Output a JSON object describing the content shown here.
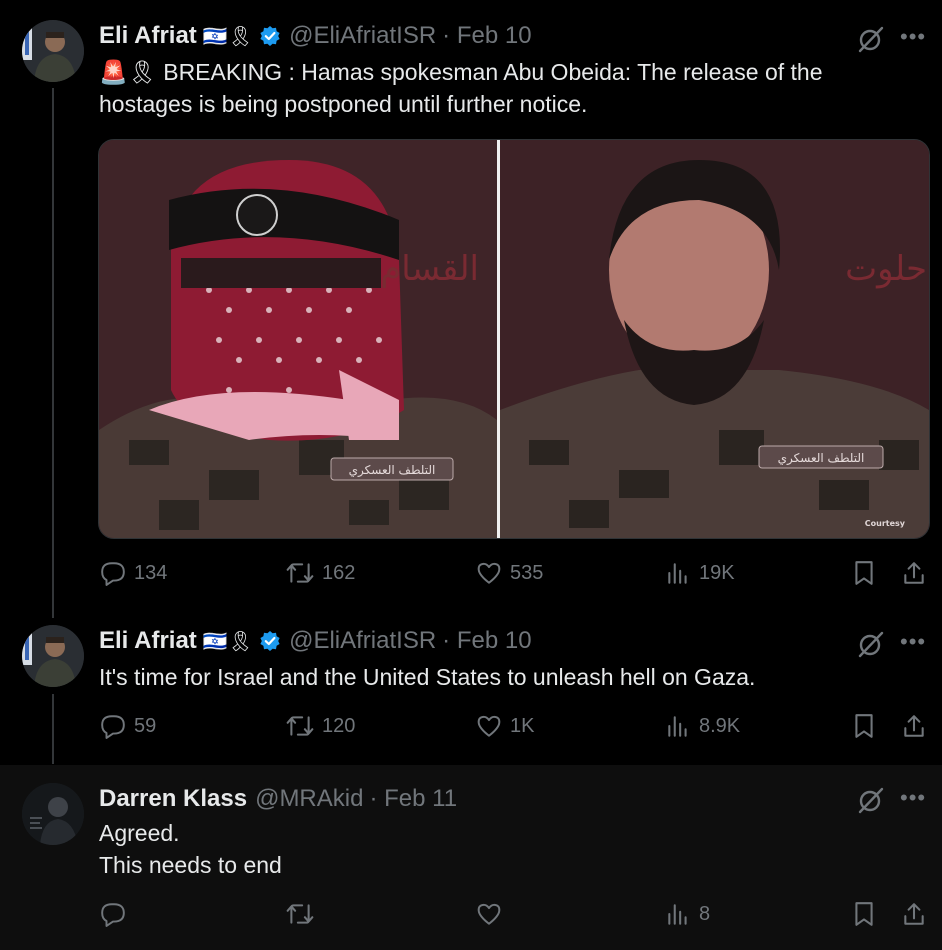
{
  "tweets": [
    {
      "name": "Eli Afriat",
      "badges": "🇮🇱🎗",
      "handle": "@EliAfriatISR",
      "date": "· Feb 10",
      "text_prefix": "🚨🎗 ",
      "text": "BREAKING : Hamas spokesman Abu Obeida: The release of the hostages is being postponed until further notice.",
      "media": {
        "left_caption": "القسام",
        "right_caption": "حلوت",
        "badge_left": "التلطف العسكري",
        "badge_right": "التلطف العسكري",
        "credit": "Courtesy"
      },
      "stats": {
        "replies": "134",
        "reposts": "162",
        "likes": "535",
        "views": "19K"
      }
    },
    {
      "name": "Eli Afriat",
      "badges": "🇮🇱🎗",
      "handle": "@EliAfriatISR",
      "date": "· Feb 10",
      "text": "It's time for Israel and the United States to unleash hell on Gaza.",
      "stats": {
        "replies": "59",
        "reposts": "120",
        "likes": "1K",
        "views": "8.9K"
      }
    },
    {
      "name": "Darren Klass",
      "handle": "@MRAkid",
      "date": "· Feb 11",
      "text_line1": "Agreed.",
      "text_line2": "This needs to end",
      "stats": {
        "replies": "",
        "reposts": "",
        "likes": "",
        "views": "8"
      }
    }
  ],
  "icons": {
    "reply": "reply-icon",
    "repost": "repost-icon",
    "like": "heart-icon",
    "views": "views-icon",
    "bookmark": "bookmark-icon",
    "share": "share-icon",
    "grok": "grok-icon",
    "more": "more-icon",
    "verified": "verified-icon"
  },
  "colors": {
    "background": "#000000",
    "text": "#e7e9ea",
    "secondary": "#71767b",
    "verified": "#1d9bf0"
  }
}
